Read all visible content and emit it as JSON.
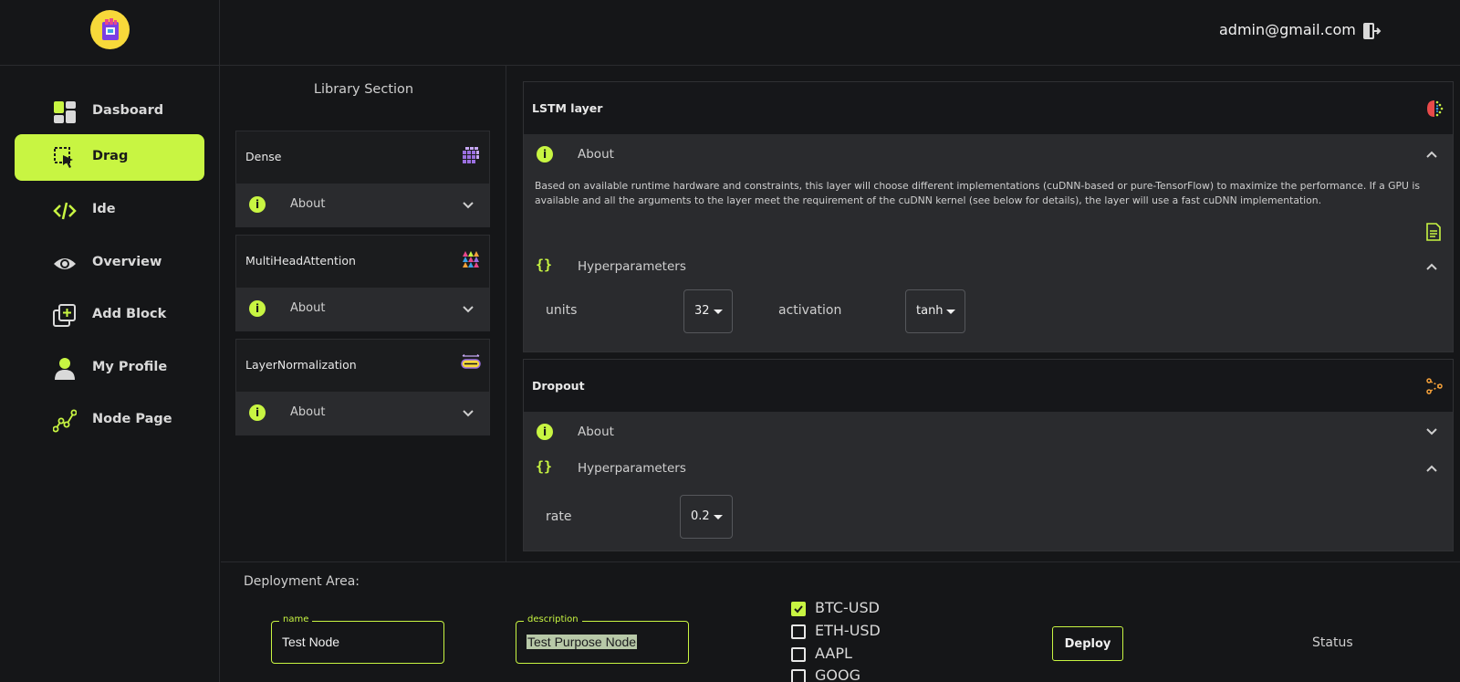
{
  "header": {
    "user_email": "admin@gmail.com"
  },
  "sidebar": {
    "items": [
      {
        "label": "Dasboard",
        "icon": "dashboard-icon",
        "active": false
      },
      {
        "label": "Drag",
        "icon": "drag-icon",
        "active": true
      },
      {
        "label": "Ide",
        "icon": "code-icon",
        "active": false
      },
      {
        "label": "Overview",
        "icon": "eye-icon",
        "active": false
      },
      {
        "label": "Add Block",
        "icon": "add-block-icon",
        "active": false
      },
      {
        "label": "My Profile",
        "icon": "profile-icon",
        "active": false
      },
      {
        "label": "Node Page",
        "icon": "graph-icon",
        "active": false
      }
    ]
  },
  "library": {
    "title": "Library Section",
    "cards": [
      {
        "name": "Dense",
        "about": "About",
        "icon": "cube-grid-icon"
      },
      {
        "name": "MultiHeadAttention",
        "about": "About",
        "icon": "attention-icon"
      },
      {
        "name": "LayerNormalization",
        "about": "About",
        "icon": "normalization-icon"
      }
    ]
  },
  "panels": {
    "lstm": {
      "title": "LSTM layer",
      "about_label": "About",
      "description": "Based on available runtime hardware and constraints, this layer will choose different implementations (cuDNN-based or pure-TensorFlow) to maximize the performance. If a GPU is available and all the arguments to the layer meet the requirement of the cuDNN kernel (see below for details), the layer will use a fast cuDNN implementation.",
      "hyper_label": "Hyperparameters",
      "params": [
        {
          "name": "units",
          "value": "32"
        },
        {
          "name": "activation",
          "value": "tanh"
        }
      ]
    },
    "dropout": {
      "title": "Dropout",
      "about_label": "About",
      "hyper_label": "Hyperparameters",
      "params": [
        {
          "name": "rate",
          "value": "0.2"
        }
      ]
    }
  },
  "deploy": {
    "title": "Deployment Area:",
    "name_label": "name",
    "name_value": "Test Node",
    "desc_label": "description",
    "desc_value": "Test Purpose Node",
    "tickers": [
      {
        "label": "BTC-USD",
        "checked": true
      },
      {
        "label": "ETH-USD",
        "checked": false
      },
      {
        "label": "AAPL",
        "checked": false
      },
      {
        "label": "GOOG",
        "checked": false
      }
    ],
    "deploy_button": "Deploy",
    "status_label": "Status"
  },
  "colors": {
    "accent": "#c8f542",
    "background": "#151618",
    "panel": "#2a2b2e"
  }
}
